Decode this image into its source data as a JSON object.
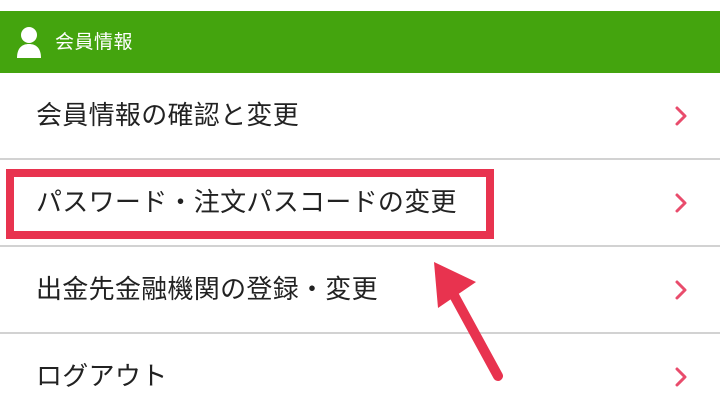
{
  "header": {
    "title": "会員情報",
    "icon": "user-icon",
    "background_color": "#44a40e"
  },
  "menu": {
    "items": [
      {
        "label": "会員情報の確認と変更",
        "icon": "chevron-right-icon"
      },
      {
        "label": "パスワード・注文パスコードの変更",
        "icon": "chevron-right-icon"
      },
      {
        "label": "出金先金融機関の登録・変更",
        "icon": "chevron-right-icon"
      },
      {
        "label": "ログアウト",
        "icon": "chevron-right-icon"
      }
    ],
    "chevron_color": "#e94c6c"
  },
  "annotation": {
    "highlight_color": "#e8334f",
    "highlighted_item": "パスワード・注文パスコードの変更"
  }
}
